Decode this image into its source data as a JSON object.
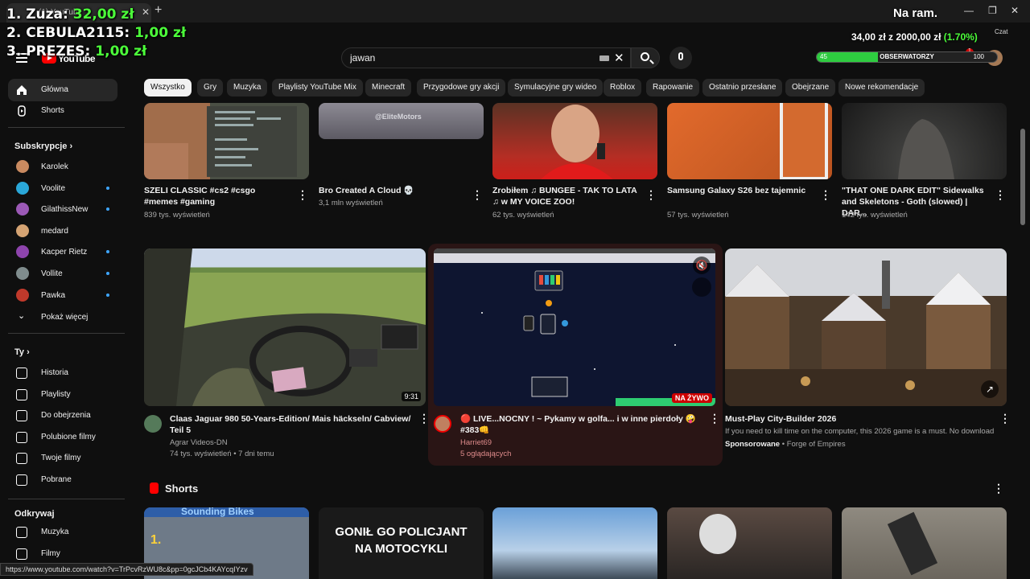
{
  "browser": {
    "tab_title": "(1) YouTube",
    "status_url": "https://www.youtube.com/watch?v=TrPcvRzWU8c&pp=0gcJCb4KAYcqIYzv"
  },
  "overlay": {
    "leaderboard": [
      {
        "name": "1. Zuza:",
        "amount": "32,00 zł"
      },
      {
        "name": "2. CEBULA2115:",
        "amount": "1,00 zł"
      },
      {
        "name": "3. PREZES:",
        "amount": "1,00 zł"
      }
    ],
    "na_ram": "Na ram.",
    "goal_text": "34,00 zł z 2000,00 zł",
    "goal_pct": "(1.70%)",
    "goal_fraction": 0.017,
    "goal_bar_label": "OBSERWATORZY",
    "goal_bar_min": "45",
    "goal_bar_max": "100",
    "chat_label": "Czat"
  },
  "masthead": {
    "logo_text": "YouTube",
    "search_value": "jawan",
    "notification_count": "1"
  },
  "sidebar": {
    "main": [
      {
        "label": "Główna",
        "icon": "home-icon"
      },
      {
        "label": "Shorts",
        "icon": "shorts-icon"
      }
    ],
    "subs_heading": "Subskrypcje",
    "subs": [
      {
        "label": "Karolek",
        "color": "#c98a60",
        "dot": false
      },
      {
        "label": "Voolite",
        "color": "#2aa7d8",
        "dot": true
      },
      {
        "label": "GilathissNew",
        "color": "#9b59b6",
        "dot": true
      },
      {
        "label": "medard",
        "color": "#d4a373",
        "dot": false
      },
      {
        "label": "Kacper Rietz",
        "color": "#8e44ad",
        "dot": true
      },
      {
        "label": "Vollite",
        "color": "#7f8c8d",
        "dot": true
      },
      {
        "label": "Pawka",
        "color": "#c0392b",
        "dot": true
      }
    ],
    "show_more": "Pokaż więcej",
    "you_heading": "Ty",
    "you": [
      {
        "label": "Historia",
        "icon": "history-icon"
      },
      {
        "label": "Playlisty",
        "icon": "playlists-icon"
      },
      {
        "label": "Do obejrzenia",
        "icon": "watch-later-icon"
      },
      {
        "label": "Polubione filmy",
        "icon": "liked-icon"
      },
      {
        "label": "Twoje filmy",
        "icon": "your-videos-icon"
      },
      {
        "label": "Pobrane",
        "icon": "download-icon"
      }
    ],
    "explore_heading": "Odkrywaj",
    "explore": [
      {
        "label": "Muzyka",
        "icon": "music-icon"
      },
      {
        "label": "Filmy",
        "icon": "movies-icon"
      }
    ]
  },
  "chips": [
    "Wszystko",
    "Gry",
    "Muzyka",
    "Playlisty YouTube Mix",
    "Minecraft",
    "Przygodowe gry akcji",
    "Symulacyjne gry wideo",
    "Roblox",
    "Rapowanie",
    "Ostatnio przesłane",
    "Obejrzane",
    "Nowe rekomendacje"
  ],
  "row1": [
    {
      "title": "SZELI CLASSIC  #cs2 #csgo #memes #gaming",
      "meta": "839 tys. wyświetleń"
    },
    {
      "title": "Bro Created A Cloud 💀",
      "meta": "3,1 mln wyświetleń",
      "watermark": "@EliteMotors"
    },
    {
      "title": "Zrobiłem ♫ BUNGEE - TAK TO LATA ♫ w MY VOICE ZOO!",
      "meta": "62 tys. wyświetleń"
    },
    {
      "title": "Samsung Galaxy S26 bez tajemnic",
      "meta": "57 tys. wyświetleń"
    },
    {
      "title": "\"THAT ONE DARK EDIT\" Sidewalks and Skeletons - Goth (slowed) | DAR...",
      "meta": "142 tys. wyświetleń"
    }
  ],
  "row2": [
    {
      "title": "Claas Jaguar 980 50-Years-Edition/ Mais häckseln/ Cabview/ Teil 5",
      "channel": "Agrar Videos-DN",
      "meta": "74 tys. wyświetleń • 7 dni temu",
      "duration": "9:31"
    },
    {
      "title": "🔴 LIVE...NOCNY ! ~ Pykamy w golfa... i w inne pierdoły 🤪 #383👊",
      "channel": "Harriet69",
      "meta": "5 oglądających",
      "live": "NA ŻYWO"
    },
    {
      "title": "Must-Play City-Builder 2026",
      "desc": "If you need to kill time on the computer, this 2026 game is a must. No download",
      "sponsored": "Sponsorowane",
      "channel": "Forge of Empires"
    }
  ],
  "shorts": {
    "heading": "Shorts",
    "items": [
      {
        "caption": "Sounding Bikes"
      },
      {
        "caption": "GONIŁ GO POLICJANT NA MOTOCYKLI"
      },
      {
        "caption": ""
      },
      {
        "caption": ""
      },
      {
        "caption": ""
      }
    ]
  }
}
